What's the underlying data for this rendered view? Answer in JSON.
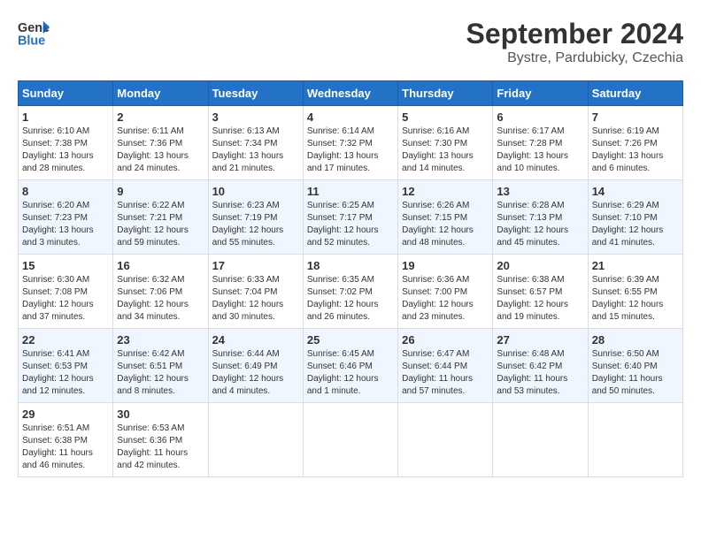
{
  "header": {
    "logo_line1": "General",
    "logo_line2": "Blue",
    "title": "September 2024",
    "subtitle": "Bystre, Pardubicky, Czechia"
  },
  "weekdays": [
    "Sunday",
    "Monday",
    "Tuesday",
    "Wednesday",
    "Thursday",
    "Friday",
    "Saturday"
  ],
  "weeks": [
    [
      {
        "day": "1",
        "rise": "Sunrise: 6:10 AM",
        "set": "Sunset: 7:38 PM",
        "light": "Daylight: 13 hours and 28 minutes."
      },
      {
        "day": "2",
        "rise": "Sunrise: 6:11 AM",
        "set": "Sunset: 7:36 PM",
        "light": "Daylight: 13 hours and 24 minutes."
      },
      {
        "day": "3",
        "rise": "Sunrise: 6:13 AM",
        "set": "Sunset: 7:34 PM",
        "light": "Daylight: 13 hours and 21 minutes."
      },
      {
        "day": "4",
        "rise": "Sunrise: 6:14 AM",
        "set": "Sunset: 7:32 PM",
        "light": "Daylight: 13 hours and 17 minutes."
      },
      {
        "day": "5",
        "rise": "Sunrise: 6:16 AM",
        "set": "Sunset: 7:30 PM",
        "light": "Daylight: 13 hours and 14 minutes."
      },
      {
        "day": "6",
        "rise": "Sunrise: 6:17 AM",
        "set": "Sunset: 7:28 PM",
        "light": "Daylight: 13 hours and 10 minutes."
      },
      {
        "day": "7",
        "rise": "Sunrise: 6:19 AM",
        "set": "Sunset: 7:26 PM",
        "light": "Daylight: 13 hours and 6 minutes."
      }
    ],
    [
      {
        "day": "8",
        "rise": "Sunrise: 6:20 AM",
        "set": "Sunset: 7:23 PM",
        "light": "Daylight: 13 hours and 3 minutes."
      },
      {
        "day": "9",
        "rise": "Sunrise: 6:22 AM",
        "set": "Sunset: 7:21 PM",
        "light": "Daylight: 12 hours and 59 minutes."
      },
      {
        "day": "10",
        "rise": "Sunrise: 6:23 AM",
        "set": "Sunset: 7:19 PM",
        "light": "Daylight: 12 hours and 55 minutes."
      },
      {
        "day": "11",
        "rise": "Sunrise: 6:25 AM",
        "set": "Sunset: 7:17 PM",
        "light": "Daylight: 12 hours and 52 minutes."
      },
      {
        "day": "12",
        "rise": "Sunrise: 6:26 AM",
        "set": "Sunset: 7:15 PM",
        "light": "Daylight: 12 hours and 48 minutes."
      },
      {
        "day": "13",
        "rise": "Sunrise: 6:28 AM",
        "set": "Sunset: 7:13 PM",
        "light": "Daylight: 12 hours and 45 minutes."
      },
      {
        "day": "14",
        "rise": "Sunrise: 6:29 AM",
        "set": "Sunset: 7:10 PM",
        "light": "Daylight: 12 hours and 41 minutes."
      }
    ],
    [
      {
        "day": "15",
        "rise": "Sunrise: 6:30 AM",
        "set": "Sunset: 7:08 PM",
        "light": "Daylight: 12 hours and 37 minutes."
      },
      {
        "day": "16",
        "rise": "Sunrise: 6:32 AM",
        "set": "Sunset: 7:06 PM",
        "light": "Daylight: 12 hours and 34 minutes."
      },
      {
        "day": "17",
        "rise": "Sunrise: 6:33 AM",
        "set": "Sunset: 7:04 PM",
        "light": "Daylight: 12 hours and 30 minutes."
      },
      {
        "day": "18",
        "rise": "Sunrise: 6:35 AM",
        "set": "Sunset: 7:02 PM",
        "light": "Daylight: 12 hours and 26 minutes."
      },
      {
        "day": "19",
        "rise": "Sunrise: 6:36 AM",
        "set": "Sunset: 7:00 PM",
        "light": "Daylight: 12 hours and 23 minutes."
      },
      {
        "day": "20",
        "rise": "Sunrise: 6:38 AM",
        "set": "Sunset: 6:57 PM",
        "light": "Daylight: 12 hours and 19 minutes."
      },
      {
        "day": "21",
        "rise": "Sunrise: 6:39 AM",
        "set": "Sunset: 6:55 PM",
        "light": "Daylight: 12 hours and 15 minutes."
      }
    ],
    [
      {
        "day": "22",
        "rise": "Sunrise: 6:41 AM",
        "set": "Sunset: 6:53 PM",
        "light": "Daylight: 12 hours and 12 minutes."
      },
      {
        "day": "23",
        "rise": "Sunrise: 6:42 AM",
        "set": "Sunset: 6:51 PM",
        "light": "Daylight: 12 hours and 8 minutes."
      },
      {
        "day": "24",
        "rise": "Sunrise: 6:44 AM",
        "set": "Sunset: 6:49 PM",
        "light": "Daylight: 12 hours and 4 minutes."
      },
      {
        "day": "25",
        "rise": "Sunrise: 6:45 AM",
        "set": "Sunset: 6:46 PM",
        "light": "Daylight: 12 hours and 1 minute."
      },
      {
        "day": "26",
        "rise": "Sunrise: 6:47 AM",
        "set": "Sunset: 6:44 PM",
        "light": "Daylight: 11 hours and 57 minutes."
      },
      {
        "day": "27",
        "rise": "Sunrise: 6:48 AM",
        "set": "Sunset: 6:42 PM",
        "light": "Daylight: 11 hours and 53 minutes."
      },
      {
        "day": "28",
        "rise": "Sunrise: 6:50 AM",
        "set": "Sunset: 6:40 PM",
        "light": "Daylight: 11 hours and 50 minutes."
      }
    ],
    [
      {
        "day": "29",
        "rise": "Sunrise: 6:51 AM",
        "set": "Sunset: 6:38 PM",
        "light": "Daylight: 11 hours and 46 minutes."
      },
      {
        "day": "30",
        "rise": "Sunrise: 6:53 AM",
        "set": "Sunset: 6:36 PM",
        "light": "Daylight: 11 hours and 42 minutes."
      },
      {
        "day": "",
        "rise": "",
        "set": "",
        "light": ""
      },
      {
        "day": "",
        "rise": "",
        "set": "",
        "light": ""
      },
      {
        "day": "",
        "rise": "",
        "set": "",
        "light": ""
      },
      {
        "day": "",
        "rise": "",
        "set": "",
        "light": ""
      },
      {
        "day": "",
        "rise": "",
        "set": "",
        "light": ""
      }
    ]
  ]
}
